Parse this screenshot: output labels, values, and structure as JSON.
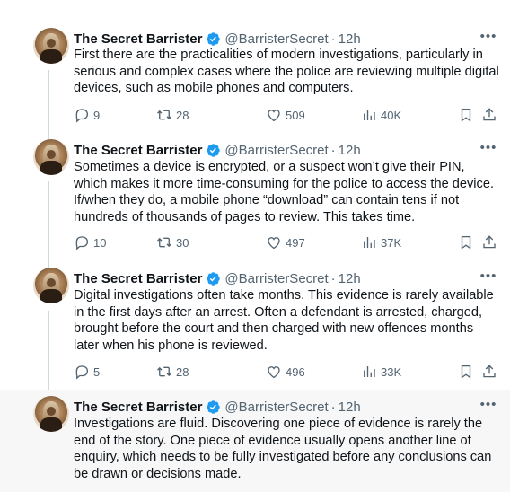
{
  "author": {
    "name": "The Secret Barrister",
    "handle": "@BarristerSecret",
    "separator": "·",
    "verified_color": "#1d9bf0"
  },
  "tweets": [
    {
      "time": "12h",
      "text": "First there are the practicalities of modern investigations, particularly in serious and complex cases where the police are reviewing multiple digital devices, such as mobile phones and computers.",
      "replies": "9",
      "retweets": "28",
      "likes": "509",
      "views": "40K"
    },
    {
      "time": "12h",
      "text": "Sometimes a device is encrypted, or a suspect won’t give their PIN, which makes it more time-consuming for the police to access the device. If/when they do, a mobile phone “download” can contain tens if not hundreds of thousands of pages to review. This takes time.",
      "replies": "10",
      "retweets": "30",
      "likes": "497",
      "views": "37K"
    },
    {
      "time": "12h",
      "text": "Digital investigations often take months. This evidence is rarely available in the first days after an arrest. Often a defendant is arrested, charged, brought before the court and then charged with new offences months later when his phone is reviewed.",
      "replies": "5",
      "retweets": "28",
      "likes": "496",
      "views": "33K"
    },
    {
      "time": "12h",
      "text": "Investigations are fluid. Discovering one piece of evidence is rarely the end of the story. One piece of evidence usually opens another line of enquiry, which needs to be fully investigated before any conclusions can be drawn or decisions made."
    }
  ],
  "icons": {
    "more": "more-icon",
    "reply": "reply-icon",
    "retweet": "retweet-icon",
    "like": "heart-icon",
    "views": "views-icon",
    "bookmark": "bookmark-icon",
    "share": "share-icon",
    "verified": "verified-badge-icon"
  },
  "colors": {
    "text": "#0f1419",
    "secondary": "#536471",
    "thread_line": "#cfd9de",
    "highlight_bg": "#f7f7f7"
  }
}
